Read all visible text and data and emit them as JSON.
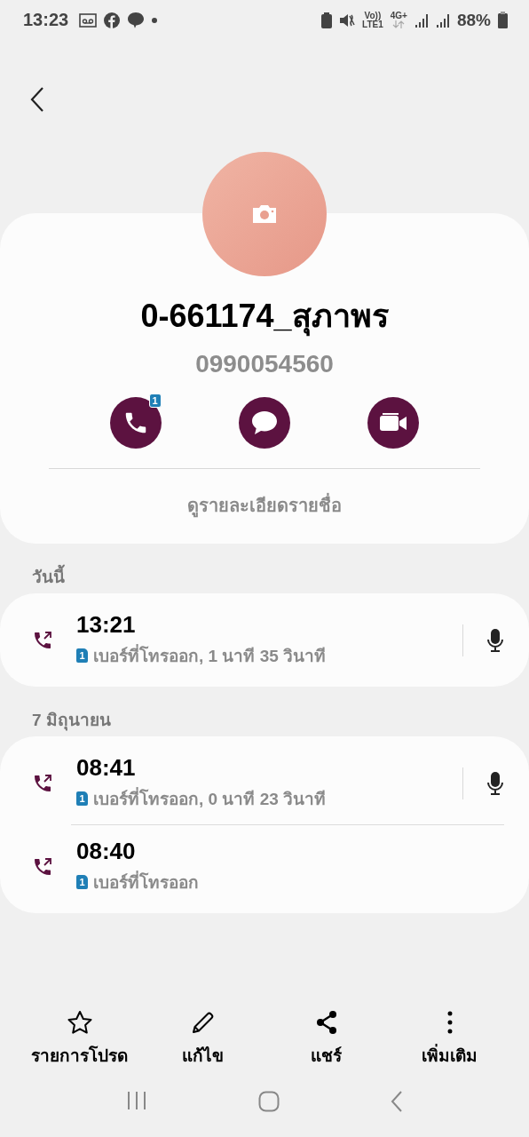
{
  "status_bar": {
    "time": "13:23",
    "volte": "Vo))",
    "lte": "LTE1",
    "network": "4G+",
    "battery": "88%"
  },
  "contact": {
    "name": "0-661174_สุภาพร",
    "number": "0990054560",
    "call_badge": "1",
    "details_link": "ดูรายละเอียดรายชื่อ"
  },
  "call_groups": [
    {
      "date": "วันนี้",
      "calls": [
        {
          "kind": "outgoing",
          "time": "13:21",
          "sim": "1",
          "detail": "เบอร์ที่โทรออก, 1 นาที 35 วินาที",
          "recording": true
        }
      ]
    },
    {
      "date": "7 มิถุนายน",
      "calls": [
        {
          "kind": "outgoing",
          "time": "08:41",
          "sim": "1",
          "detail": "เบอร์ที่โทรออก, 0 นาที 23 วินาที",
          "recording": true
        },
        {
          "kind": "outgoing",
          "time": "08:40",
          "sim": "1",
          "detail": "เบอร์ที่โทรออก",
          "recording": false
        }
      ]
    }
  ],
  "bottom_actions": [
    {
      "kind": "favorite",
      "label": "รายการโปรด"
    },
    {
      "kind": "edit",
      "label": "แก้ไข"
    },
    {
      "kind": "share",
      "label": "แชร์"
    },
    {
      "kind": "more",
      "label": "เพิ่มเติม"
    }
  ]
}
